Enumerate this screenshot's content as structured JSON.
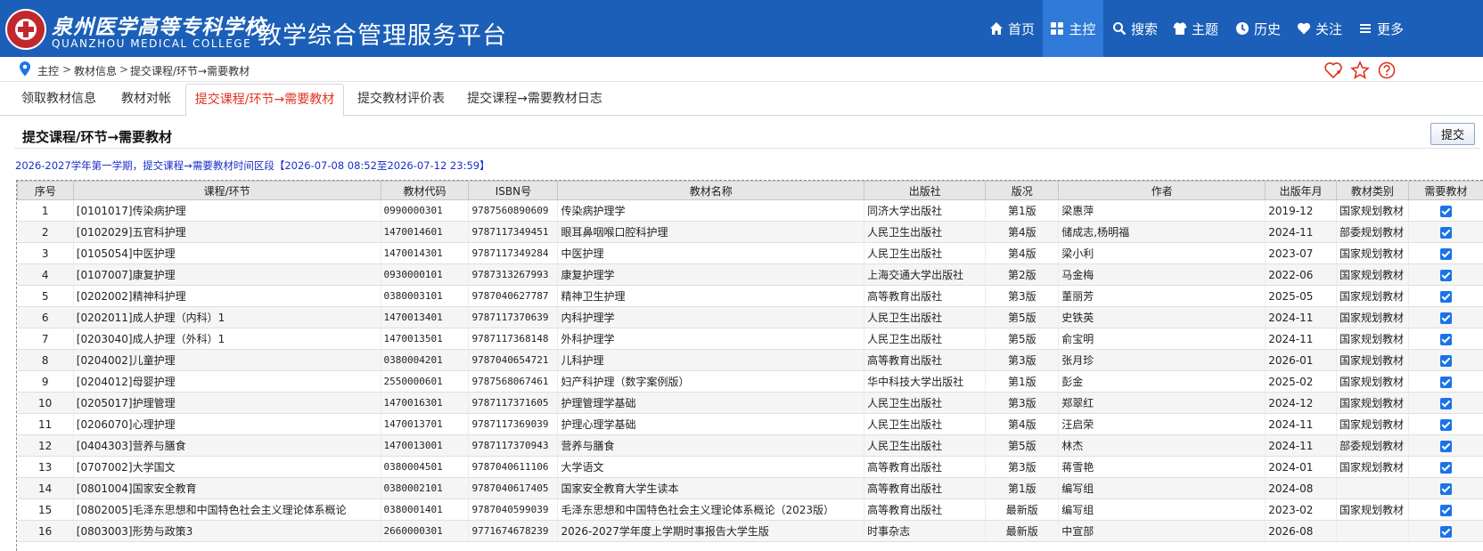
{
  "header": {
    "logo_cn": "泉州医学高等专科学校",
    "logo_en": "QUANZHOU MEDICAL COLLEGE",
    "app_title": "教学综合管理服务平台",
    "nav": [
      {
        "label": "首页",
        "icon": "home-icon"
      },
      {
        "label": "主控",
        "icon": "grid-icon",
        "active": true
      },
      {
        "label": "搜索",
        "icon": "search-icon"
      },
      {
        "label": "主题",
        "icon": "shirt-icon"
      },
      {
        "label": "历史",
        "icon": "clock-icon"
      },
      {
        "label": "关注",
        "icon": "heart-icon"
      },
      {
        "label": "更多",
        "icon": "menu-icon"
      }
    ]
  },
  "breadcrumb": [
    "主控",
    "教材信息",
    "提交课程/环节→需要教材"
  ],
  "tabs": [
    {
      "label": "领取教材信息"
    },
    {
      "label": "教材对帐"
    },
    {
      "label": "提交课程/环节→需要教材",
      "active": true
    },
    {
      "label": "提交教材评价表"
    },
    {
      "label": "提交课程→需要教材日志"
    }
  ],
  "section": {
    "title": "提交课程/环节→需要教材",
    "submit_label": "提交",
    "period_note": "2026-2027学年第一学期，提交课程→需要教材时间区段【2026-07-08 08:52至2026-07-12 23:59】"
  },
  "table": {
    "headers": [
      "序号",
      "课程/环节",
      "教材代码",
      "ISBN号",
      "教材名称",
      "出版社",
      "版况",
      "作者",
      "出版年月",
      "教材类别",
      "需要教材"
    ],
    "rows": [
      [
        "1",
        "[0101017]传染病护理",
        "0990000301",
        "9787560890609",
        "传染病护理学",
        "同济大学出版社",
        "第1版",
        "梁惠萍",
        "2019-12",
        "国家规划教材",
        true
      ],
      [
        "2",
        "[0102029]五官科护理",
        "1470014601",
        "9787117349451",
        "眼耳鼻咽喉口腔科护理",
        "人民卫生出版社",
        "第4版",
        "储成志,杨明福",
        "2024-11",
        "部委规划教材",
        true
      ],
      [
        "3",
        "[0105054]中医护理",
        "1470014301",
        "9787117349284",
        "中医护理",
        "人民卫生出版社",
        "第4版",
        "梁小利",
        "2023-07",
        "国家规划教材",
        true
      ],
      [
        "4",
        "[0107007]康复护理",
        "0930000101",
        "9787313267993",
        "康复护理学",
        "上海交通大学出版社",
        "第2版",
        "马金梅",
        "2022-06",
        "国家规划教材",
        true
      ],
      [
        "5",
        "[0202002]精神科护理",
        "0380003101",
        "9787040627787",
        "精神卫生护理",
        "高等教育出版社",
        "第3版",
        "董丽芳",
        "2025-05",
        "国家规划教材",
        true
      ],
      [
        "6",
        "[0202011]成人护理（内科）1",
        "1470013401",
        "9787117370639",
        "内科护理学",
        "人民卫生出版社",
        "第5版",
        "史铁英",
        "2024-11",
        "国家规划教材",
        true
      ],
      [
        "7",
        "[0203040]成人护理（外科）1",
        "1470013501",
        "9787117368148",
        "外科护理学",
        "人民卫生出版社",
        "第5版",
        "俞宝明",
        "2024-11",
        "国家规划教材",
        true
      ],
      [
        "8",
        "[0204002]儿童护理",
        "0380004201",
        "9787040654721",
        "儿科护理",
        "高等教育出版社",
        "第3版",
        "张月珍",
        "2026-01",
        "国家规划教材",
        true
      ],
      [
        "9",
        "[0204012]母婴护理",
        "2550000601",
        "9787568067461",
        "妇产科护理（数字案例版）",
        "华中科技大学出版社",
        "第1版",
        "彭金",
        "2025-02",
        "国家规划教材",
        true
      ],
      [
        "10",
        "[0205017]护理管理",
        "1470016301",
        "9787117371605",
        "护理管理学基础",
        "人民卫生出版社",
        "第3版",
        "郑翠红",
        "2024-12",
        "国家规划教材",
        true
      ],
      [
        "11",
        "[0206070]心理护理",
        "1470013701",
        "9787117369039",
        "护理心理学基础",
        "人民卫生出版社",
        "第4版",
        "汪启荣",
        "2024-11",
        "国家规划教材",
        true
      ],
      [
        "12",
        "[0404303]营养与膳食",
        "1470013001",
        "9787117370943",
        "营养与膳食",
        "人民卫生出版社",
        "第5版",
        "林杰",
        "2024-11",
        "部委规划教材",
        true
      ],
      [
        "13",
        "[0707002]大学国文",
        "0380004501",
        "9787040611106",
        "大学语文",
        "高等教育出版社",
        "第3版",
        "蒋雪艳",
        "2024-01",
        "国家规划教材",
        true
      ],
      [
        "14",
        "[0801004]国家安全教育",
        "0380002101",
        "9787040617405",
        "国家安全教育大学生读本",
        "高等教育出版社",
        "第1版",
        "编写组",
        "2024-08",
        "",
        true
      ],
      [
        "15",
        "[0802005]毛泽东思想和中国特色社会主义理论体系概论",
        "0380001401",
        "9787040599039",
        "毛泽东思想和中国特色社会主义理论体系概论（2023版）",
        "高等教育出版社",
        "最新版",
        "编写组",
        "2023-02",
        "国家规划教材",
        true
      ],
      [
        "16",
        "[0803003]形势与政策3",
        "2660000301",
        "9771674678239",
        "2026-2027学年度上学期时事报告大学生版",
        "时事杂志",
        "最新版",
        "中宣部",
        "2026-08",
        "",
        true
      ]
    ]
  }
}
